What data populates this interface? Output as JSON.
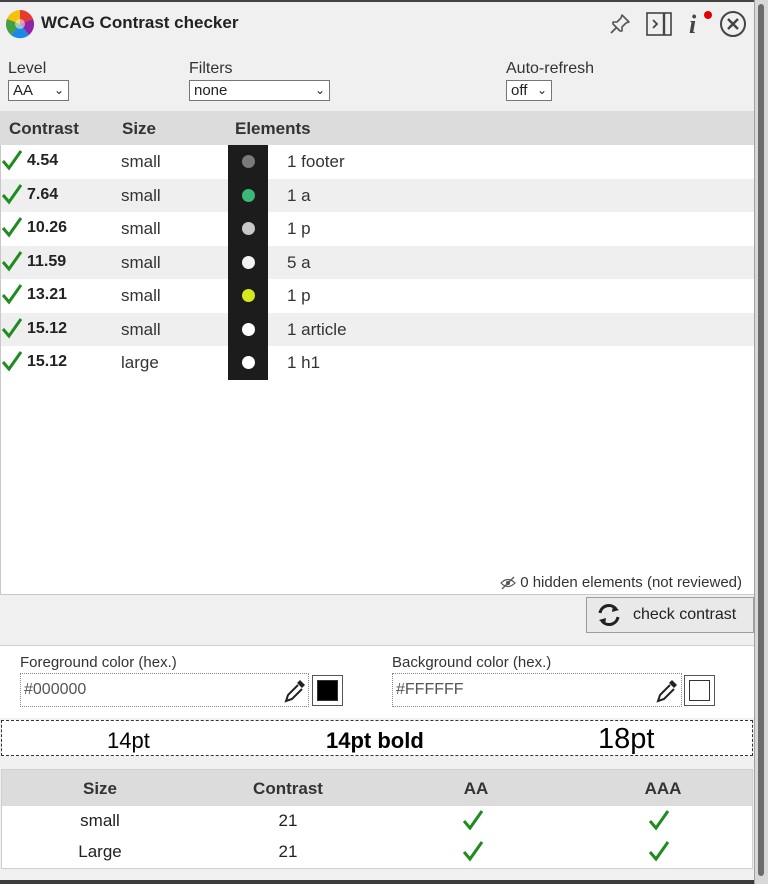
{
  "header": {
    "title": "WCAG Contrast checker",
    "icons": [
      "logo-icon",
      "pin-icon",
      "dock-sidebar-icon",
      "info-icon",
      "close-icon"
    ],
    "notification_color": "#e00000"
  },
  "controls": {
    "level_label": "Level",
    "level_value": "AA",
    "filters_label": "Filters",
    "filters_value": "none",
    "autorefresh_label": "Auto-refresh",
    "autorefresh_value": "off"
  },
  "results": {
    "headers": {
      "contrast": "Contrast",
      "size": "Size",
      "elements": "Elements"
    },
    "rows": [
      {
        "ratio": "4.54",
        "size": "small",
        "elements": "1 footer",
        "color": "#7a7a7a",
        "pass": true
      },
      {
        "ratio": "7.64",
        "size": "small",
        "elements": "1 a",
        "color": "#3cb878",
        "pass": true
      },
      {
        "ratio": "10.26",
        "size": "small",
        "elements": "1 p",
        "color": "#c8c8c8",
        "pass": true
      },
      {
        "ratio": "11.59",
        "size": "small",
        "elements": "5 a",
        "color": "#f2f2f2",
        "pass": true
      },
      {
        "ratio": "13.21",
        "size": "small",
        "elements": "1 p",
        "color": "#d4ea1e",
        "pass": true
      },
      {
        "ratio": "15.12",
        "size": "small",
        "elements": "1 article",
        "color": "#ffffff",
        "pass": true
      },
      {
        "ratio": "15.12",
        "size": "large",
        "elements": "1 h1",
        "color": "#ffffff",
        "pass": true
      }
    ],
    "swatch_bg": "#1c1c1c",
    "hidden_note": "0 hidden elements (not reviewed)"
  },
  "check_button": {
    "label": "check contrast"
  },
  "colors": {
    "fg_label": "Foreground color (hex.)",
    "fg_value": "#000000",
    "fg_swatch": "#000000",
    "bg_label": "Background color (hex.)",
    "bg_value": "#FFFFFF",
    "bg_swatch": "#FFFFFF"
  },
  "preview": {
    "normal": "14pt",
    "bold": "14pt bold",
    "large": "18pt"
  },
  "summary": {
    "headers": {
      "size": "Size",
      "contrast": "Contrast",
      "aa": "AA",
      "aaa": "AAA"
    },
    "rows": [
      {
        "size": "small",
        "contrast": "21",
        "aa": true,
        "aaa": true
      },
      {
        "size": "Large",
        "contrast": "21",
        "aa": true,
        "aaa": true
      }
    ]
  },
  "accent": {
    "check_green": "#1e8c1e"
  }
}
